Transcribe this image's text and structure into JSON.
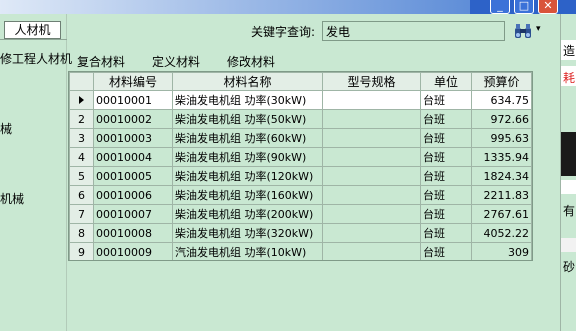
{
  "left_panel": {
    "tab_label": "人材机",
    "items": [
      "修工程人材机",
      "械",
      "机械"
    ]
  },
  "search": {
    "label": "关键字查询:",
    "value": "发电",
    "icon": "binoculars-icon"
  },
  "toolbar": {
    "items": [
      "复合材料",
      "定义材料",
      "修改材料"
    ]
  },
  "grid": {
    "columns": [
      "材料编号",
      "材料名称",
      "型号规格",
      "单位",
      "预算价"
    ],
    "rows": [
      {
        "idx": "1",
        "code": "00010001",
        "name": "柴油发电机组 功率(30kW)",
        "spec": "",
        "unit": "台班",
        "price": "634.75"
      },
      {
        "idx": "2",
        "code": "00010002",
        "name": "柴油发电机组 功率(50kW)",
        "spec": "",
        "unit": "台班",
        "price": "972.66"
      },
      {
        "idx": "3",
        "code": "00010003",
        "name": "柴油发电机组 功率(60kW)",
        "spec": "",
        "unit": "台班",
        "price": "995.63"
      },
      {
        "idx": "4",
        "code": "00010004",
        "name": "柴油发电机组 功率(90kW)",
        "spec": "",
        "unit": "台班",
        "price": "1335.94"
      },
      {
        "idx": "5",
        "code": "00010005",
        "name": "柴油发电机组 功率(120kW)",
        "spec": "",
        "unit": "台班",
        "price": "1824.34"
      },
      {
        "idx": "6",
        "code": "00010006",
        "name": "柴油发电机组 功率(160kW)",
        "spec": "",
        "unit": "台班",
        "price": "2211.83"
      },
      {
        "idx": "7",
        "code": "00010007",
        "name": "柴油发电机组 功率(200kW)",
        "spec": "",
        "unit": "台班",
        "price": "2767.61"
      },
      {
        "idx": "8",
        "code": "00010008",
        "name": "柴油发电机组 功率(320kW)",
        "spec": "",
        "unit": "台班",
        "price": "4052.22"
      },
      {
        "idx": "9",
        "code": "00010009",
        "name": "汽油发电机组 功率(10kW)",
        "spec": "",
        "unit": "台班",
        "price": "309"
      }
    ]
  },
  "right_panel": {
    "fragments": [
      "造",
      "耗",
      "有",
      "砂"
    ]
  },
  "window_buttons": {
    "minimize": "_",
    "maximize": "□",
    "close": "✕"
  },
  "colors": {
    "background": "#c9e8d2",
    "title_bar": "#2d62c8",
    "close_button": "#d9543a",
    "selected_row": "#ffffff"
  }
}
